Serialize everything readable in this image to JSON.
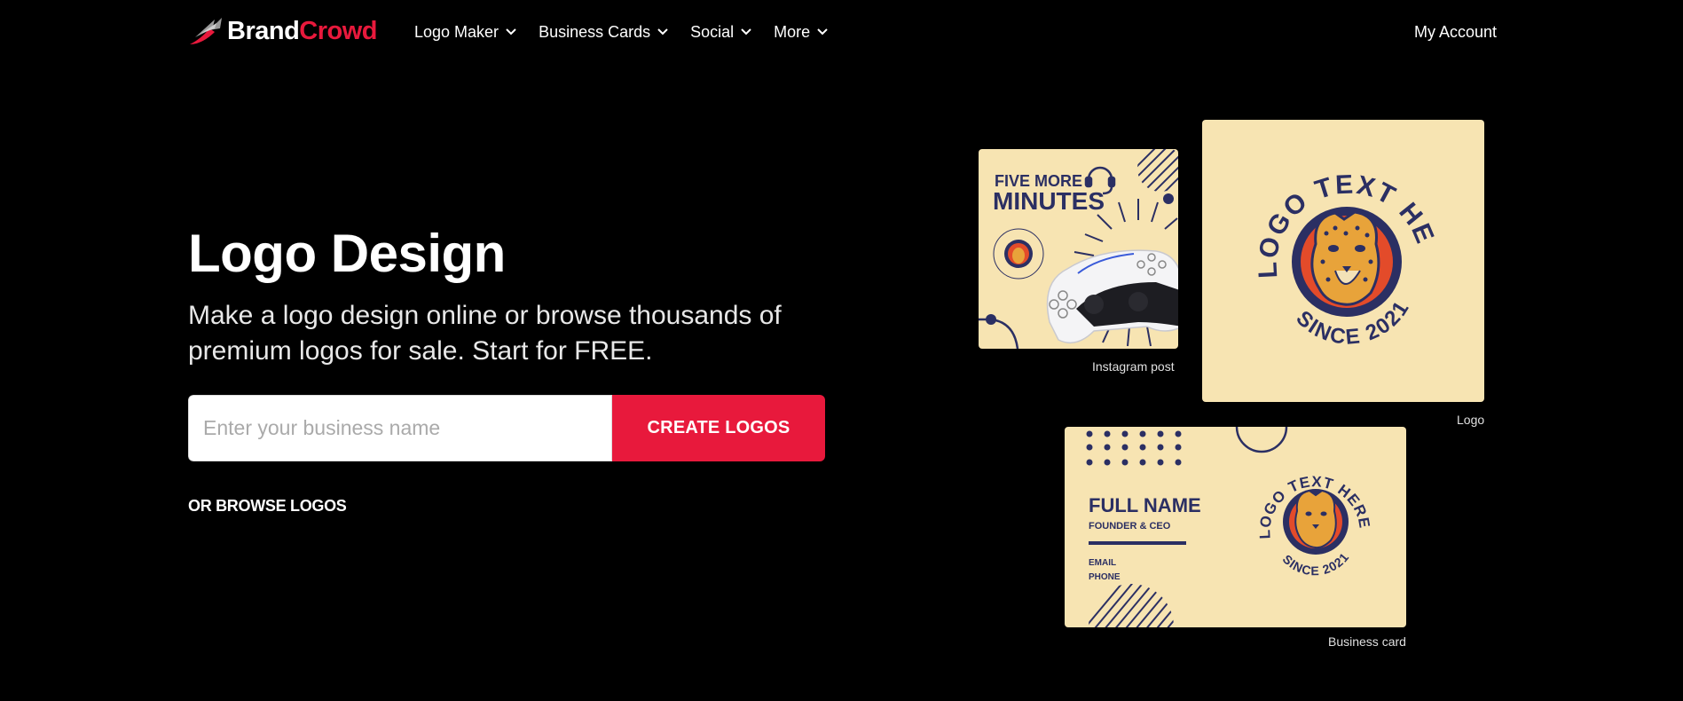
{
  "nav": {
    "brand_part1": "Brand",
    "brand_part2": "Crowd",
    "items": [
      {
        "label": "Logo Maker"
      },
      {
        "label": "Business Cards"
      },
      {
        "label": "Social"
      },
      {
        "label": "More"
      }
    ],
    "account": "My Account"
  },
  "hero": {
    "title": "Logo Design",
    "subtitle": "Make a logo design online or browse thousands of premium logos for sale. Start for FREE.",
    "input_placeholder": "Enter your business name",
    "cta": "CREATE LOGOS",
    "browse": "OR BROWSE LOGOS"
  },
  "mockups": {
    "instagram": {
      "line1": "FIVE MORE",
      "line2": "MINUTES",
      "caption": "Instagram post"
    },
    "logo": {
      "arc_top": "LOGO TEXT HERE",
      "arc_bottom": "SINCE 2021",
      "caption": "Logo"
    },
    "business_card": {
      "name": "FULL NAME",
      "role": "FOUNDER & CEO",
      "email": "EMAIL",
      "phone": "PHONE",
      "caption": "Business card"
    }
  },
  "colors": {
    "accent": "#e8193c",
    "cream": "#f7e4b2",
    "navy": "#2b2f63",
    "orange": "#e34b2a"
  }
}
